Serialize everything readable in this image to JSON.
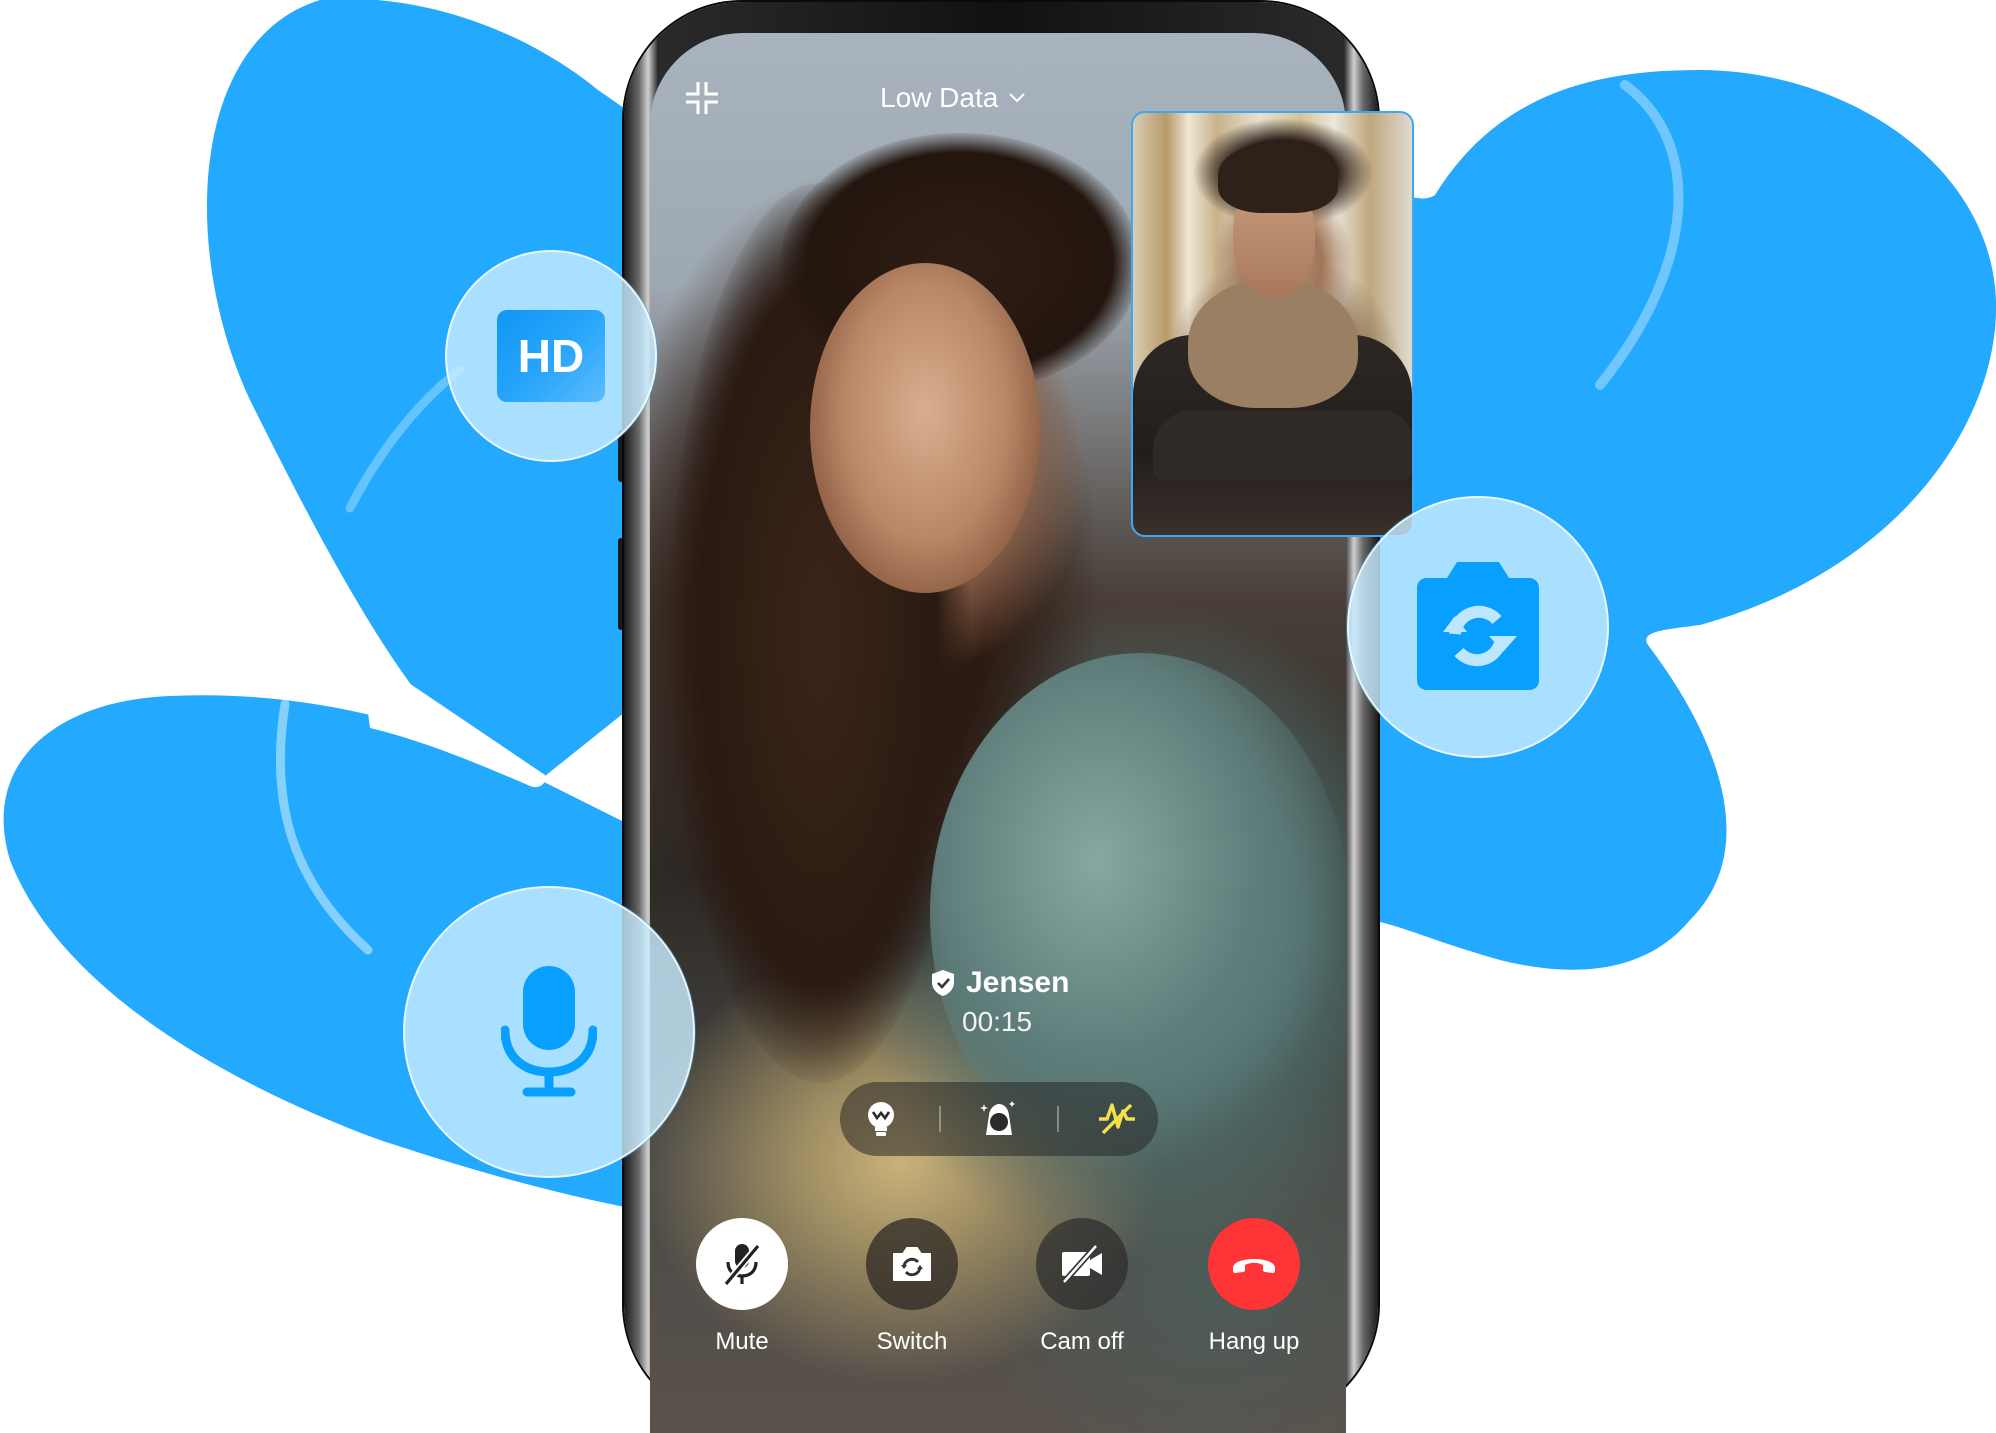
{
  "colors": {
    "blob": "#23A9FD",
    "accent": "#08A0FF",
    "pip_border": "#3AA8F2",
    "hangup": "#FF3436",
    "effect_active": "#F5E04A"
  },
  "call_screen": {
    "collapse_icon": "collapse-icon",
    "quality_selector": {
      "label": "Low Data",
      "icon": "chevron-down-icon"
    },
    "caller": {
      "name": "Jensen",
      "verified_icon": "shield-check-icon",
      "duration": "00:15"
    },
    "effects": [
      {
        "name": "light",
        "icon": "lightbulb-icon",
        "active": false
      },
      {
        "name": "beauty",
        "icon": "face-sparkle-icon",
        "active": false
      },
      {
        "name": "low-light-boost",
        "icon": "zigzag-boost-icon",
        "active": true
      }
    ],
    "controls": [
      {
        "label": "Mute",
        "icon": "mic-off-icon",
        "active": true
      },
      {
        "label": "Switch",
        "icon": "camera-switch-icon",
        "active": false
      },
      {
        "label": "Cam off",
        "icon": "video-off-icon",
        "active": false
      },
      {
        "label": "Hang up",
        "icon": "phone-hangup-icon",
        "active": false
      }
    ]
  },
  "feature_badges": [
    {
      "label": "HD",
      "icon": "hd-icon"
    },
    {
      "label": "",
      "icon": "camera-switch-icon"
    },
    {
      "label": "",
      "icon": "microphone-icon"
    }
  ]
}
